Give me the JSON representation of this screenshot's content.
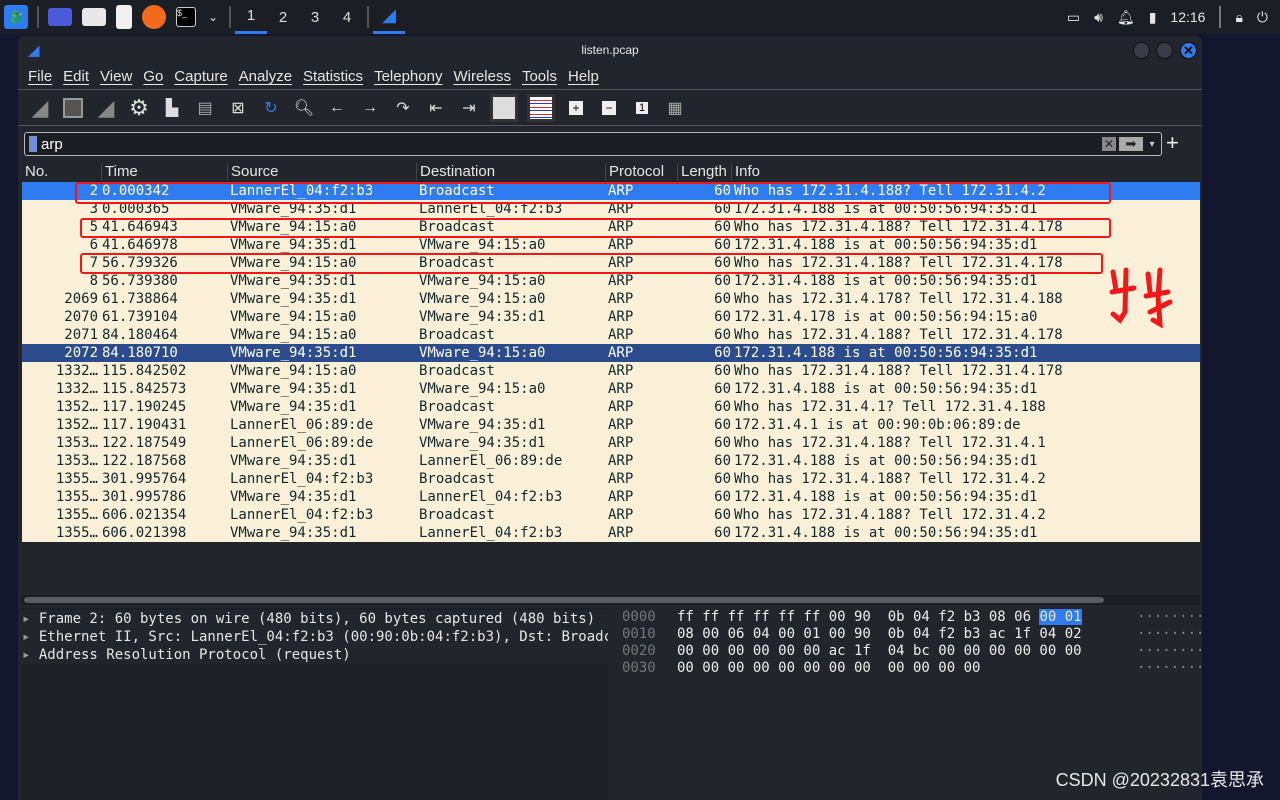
{
  "taskbar": {
    "workspaces": [
      "1",
      "2",
      "3",
      "4"
    ],
    "active_workspace": "1",
    "clock": "12:16"
  },
  "window": {
    "title": "listen.pcap"
  },
  "menu": [
    "File",
    "Edit",
    "View",
    "Go",
    "Capture",
    "Analyze",
    "Statistics",
    "Telephony",
    "Wireless",
    "Tools",
    "Help"
  ],
  "filter": {
    "value": "arp"
  },
  "columns": [
    "No.",
    "Time",
    "Source",
    "Destination",
    "Protocol",
    "Length",
    "Info"
  ],
  "packets": [
    [
      "2",
      "0.000342",
      "LannerEl_04:f2:b3",
      "Broadcast",
      "ARP",
      "60",
      "Who has 172.31.4.188? Tell 172.31.4.2",
      "selected"
    ],
    [
      "3",
      "0.000365",
      "VMware_94:35:d1",
      "LannerEl_04:f2:b3",
      "ARP",
      "60",
      "172.31.4.188 is at 00:50:56:94:35:d1",
      ""
    ],
    [
      "5",
      "41.646943",
      "VMware_94:15:a0",
      "Broadcast",
      "ARP",
      "60",
      "Who has 172.31.4.188? Tell 172.31.4.178",
      ""
    ],
    [
      "6",
      "41.646978",
      "VMware_94:35:d1",
      "VMware_94:15:a0",
      "ARP",
      "60",
      "172.31.4.188 is at 00:50:56:94:35:d1",
      ""
    ],
    [
      "7",
      "56.739326",
      "VMware_94:15:a0",
      "Broadcast",
      "ARP",
      "60",
      "Who has 172.31.4.188? Tell 172.31.4.178",
      ""
    ],
    [
      "8",
      "56.739380",
      "VMware_94:35:d1",
      "VMware_94:15:a0",
      "ARP",
      "60",
      "172.31.4.188 is at 00:50:56:94:35:d1",
      ""
    ],
    [
      "2069",
      "61.738864",
      "VMware_94:35:d1",
      "VMware_94:15:a0",
      "ARP",
      "60",
      "Who has 172.31.4.178? Tell 172.31.4.188",
      ""
    ],
    [
      "2070",
      "61.739104",
      "VMware_94:15:a0",
      "VMware_94:35:d1",
      "ARP",
      "60",
      "172.31.4.178 is at 00:50:56:94:15:a0",
      ""
    ],
    [
      "2071",
      "84.180464",
      "VMware_94:15:a0",
      "Broadcast",
      "ARP",
      "60",
      "Who has 172.31.4.188? Tell 172.31.4.178",
      ""
    ],
    [
      "2072",
      "84.180710",
      "VMware_94:35:d1",
      "VMware_94:15:a0",
      "ARP",
      "60",
      "172.31.4.188 is at 00:50:56:94:35:d1",
      "marked"
    ],
    [
      "1332…",
      "115.842502",
      "VMware_94:15:a0",
      "Broadcast",
      "ARP",
      "60",
      "Who has 172.31.4.188? Tell 172.31.4.178",
      ""
    ],
    [
      "1332…",
      "115.842573",
      "VMware_94:35:d1",
      "VMware_94:15:a0",
      "ARP",
      "60",
      "172.31.4.188 is at 00:50:56:94:35:d1",
      ""
    ],
    [
      "1352…",
      "117.190245",
      "VMware_94:35:d1",
      "Broadcast",
      "ARP",
      "60",
      "Who has 172.31.4.1? Tell 172.31.4.188",
      ""
    ],
    [
      "1352…",
      "117.190431",
      "LannerEl_06:89:de",
      "VMware_94:35:d1",
      "ARP",
      "60",
      "172.31.4.1 is at 00:90:0b:06:89:de",
      ""
    ],
    [
      "1353…",
      "122.187549",
      "LannerEl_06:89:de",
      "VMware_94:35:d1",
      "ARP",
      "60",
      "Who has 172.31.4.188? Tell 172.31.4.1",
      ""
    ],
    [
      "1353…",
      "122.187568",
      "VMware_94:35:d1",
      "LannerEl_06:89:de",
      "ARP",
      "60",
      "172.31.4.188 is at 00:50:56:94:35:d1",
      ""
    ],
    [
      "1355…",
      "301.995764",
      "LannerEl_04:f2:b3",
      "Broadcast",
      "ARP",
      "60",
      "Who has 172.31.4.188? Tell 172.31.4.2",
      ""
    ],
    [
      "1355…",
      "301.995786",
      "VMware_94:35:d1",
      "LannerEl_04:f2:b3",
      "ARP",
      "60",
      "172.31.4.188 is at 00:50:56:94:35:d1",
      ""
    ],
    [
      "1355…",
      "606.021354",
      "LannerEl_04:f2:b3",
      "Broadcast",
      "ARP",
      "60",
      "Who has 172.31.4.188? Tell 172.31.4.2",
      ""
    ],
    [
      "1355…",
      "606.021398",
      "VMware_94:35:d1",
      "LannerEl_04:f2:b3",
      "ARP",
      "60",
      "172.31.4.188 is at 00:50:56:94:35:d1",
      ""
    ]
  ],
  "details": [
    "Frame 2: 60 bytes on wire (480 bits), 60 bytes captured (480 bits)",
    "Ethernet II, Src: LannerEl_04:f2:b3 (00:90:0b:04:f2:b3), Dst: Broadcast",
    "Address Resolution Protocol (request)"
  ],
  "hex": [
    {
      "offset": "0000",
      "bytes": "ff ff ff ff ff ff 00 90  0b 04 f2 b3 08 06 ",
      "highlight": "00 01",
      "ascii": "········"
    },
    {
      "offset": "0010",
      "bytes": "08 00 06 04 00 01 00 90  0b 04 f2 b3 ac 1f 04 02",
      "highlight": "",
      "ascii": "········"
    },
    {
      "offset": "0020",
      "bytes": "00 00 00 00 00 00 ac 1f  04 bc 00 00 00 00 00 00",
      "highlight": "",
      "ascii": "········"
    },
    {
      "offset": "0030",
      "bytes": "00 00 00 00 00 00 00 00  00 00 00 00",
      "highlight": "",
      "ascii": "········"
    }
  ],
  "watermark": "CSDN @20232831袁思承",
  "colors": {
    "arp_row": "#faf0d7",
    "selected": "#2f7bf0",
    "marked": "#2c4b8c",
    "annotation": "#f2181a"
  }
}
